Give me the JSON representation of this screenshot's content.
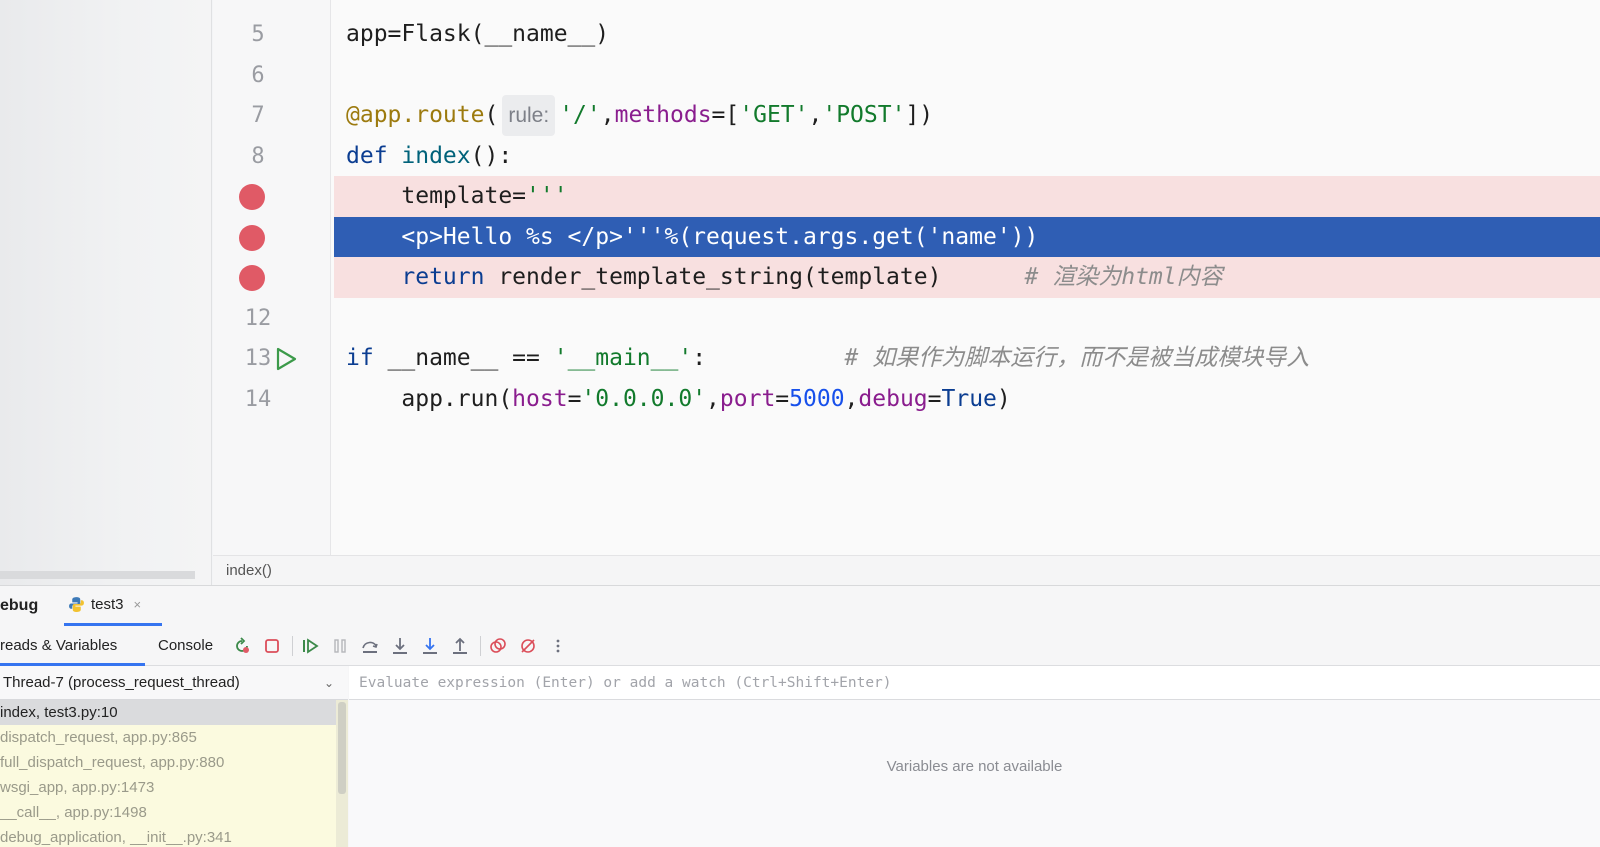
{
  "editor": {
    "lines": [
      {
        "num": "5",
        "tokens": [
          [
            "",
            "app=Flask(__name__)"
          ]
        ]
      },
      {
        "num": "6",
        "tokens": []
      },
      {
        "num": "7",
        "tokens": [
          [
            "dec",
            "@app.route"
          ],
          [
            "",
            "("
          ],
          [
            "hint",
            "rule:"
          ],
          [
            "str",
            "'/'"
          ],
          [
            "",
            ","
          ],
          [
            "param",
            "methods"
          ],
          [
            "",
            "=["
          ],
          [
            "str",
            "'GET'"
          ],
          [
            "",
            ","
          ],
          [
            "str",
            "'POST'"
          ],
          [
            "",
            "])"
          ]
        ]
      },
      {
        "num": "8",
        "tokens": [
          [
            "kw",
            "def "
          ],
          [
            "fn",
            "index"
          ],
          [
            "",
            "():"
          ]
        ]
      },
      {
        "num": "",
        "breakpoint": true,
        "tokens": [
          [
            "",
            "    template="
          ],
          [
            "str",
            "'''"
          ]
        ]
      },
      {
        "num": "",
        "breakpoint": true,
        "current": true,
        "tokens": [
          [
            "",
            "    <p>Hello %s </p>'''%(request.args.get('name'))"
          ]
        ]
      },
      {
        "num": "",
        "breakpoint": true,
        "tokens": [
          [
            "kw",
            "    return "
          ],
          [
            "",
            "render_template_string(template)      "
          ],
          [
            "cm",
            "# 渲染为html内容"
          ]
        ]
      },
      {
        "num": "12",
        "tokens": []
      },
      {
        "num": "13",
        "run": true,
        "tokens": [
          [
            "kw",
            "if "
          ],
          [
            "",
            "__name__ == "
          ],
          [
            "str",
            "'__main__'"
          ],
          [
            "",
            ":          "
          ],
          [
            "cm",
            "# 如果作为脚本运行，而不是被当成模块导入"
          ]
        ]
      },
      {
        "num": "14",
        "tokens": [
          [
            "",
            "    app.run("
          ],
          [
            "param",
            "host"
          ],
          [
            "",
            "="
          ],
          [
            "str",
            "'0.0.0.0'"
          ],
          [
            "",
            ","
          ],
          [
            "param",
            "port"
          ],
          [
            "",
            "="
          ],
          [
            "num-lit",
            "5000"
          ],
          [
            "",
            ","
          ],
          [
            "param",
            "debug"
          ],
          [
            "",
            "="
          ],
          [
            "kw",
            "True"
          ],
          [
            "",
            ")"
          ]
        ]
      }
    ]
  },
  "breadcrumb": "index()",
  "debug": {
    "title": "ebug",
    "run_tab": "test3",
    "close_glyph": "×",
    "subtabs": {
      "threads": "reads & Variables",
      "console": "Console"
    },
    "toolbar_icons": [
      "rerun-icon",
      "stop-icon",
      "resume-icon",
      "pause-icon",
      "step-over-icon",
      "step-into-icon",
      "step-into-my-code-icon",
      "step-out-icon",
      "view-breakpoints-icon",
      "mute-breakpoints-icon",
      "more-icon"
    ],
    "thread": "Thread-7 (process_request_thread)",
    "frames": [
      "index, test3.py:10",
      "dispatch_request, app.py:865",
      "full_dispatch_request, app.py:880",
      "wsgi_app, app.py:1473",
      "__call__, app.py:1498",
      "debug_application, __init__.py:341"
    ],
    "watch_placeholder": "Evaluate expression (Enter) or add a watch (Ctrl+Shift+Enter)",
    "vars_empty": "Variables are not available"
  },
  "colors": {
    "current_line": "#2f5eb4",
    "breakpoint": "#e05a66",
    "breakpoint_line": "#f8e0e0",
    "accent": "#3574f0"
  }
}
